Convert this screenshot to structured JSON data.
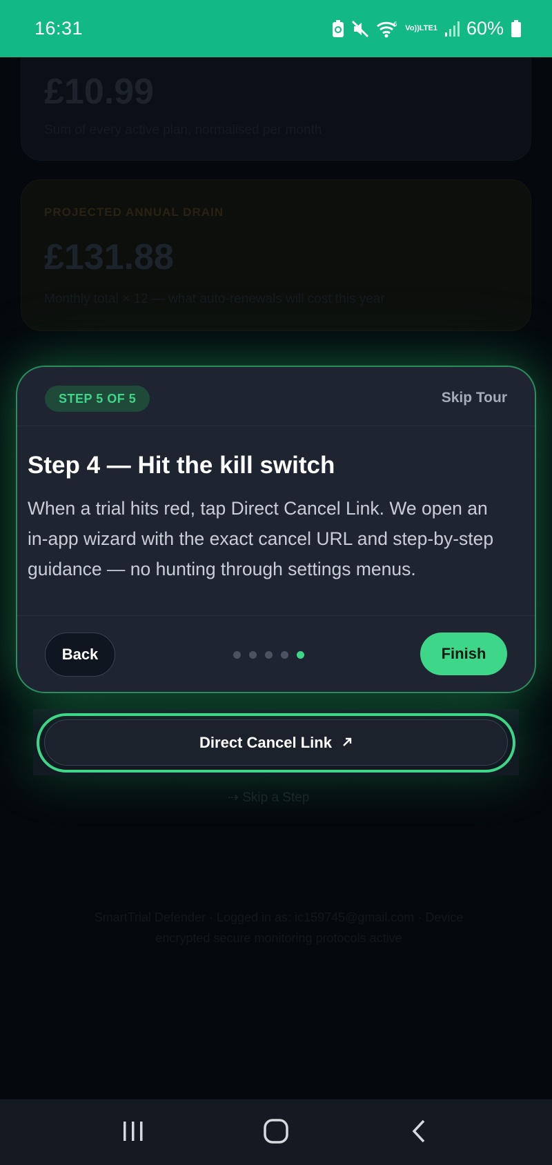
{
  "status_bar": {
    "time": "16:31",
    "network_label_top": "Vo))",
    "network_label_bottom": "LTE1",
    "battery_percent": "60%",
    "icons": [
      "battery-saver-icon",
      "mute-icon",
      "wifi-icon",
      "signal-icon",
      "battery-icon"
    ]
  },
  "background": {
    "monthly_amount": "£10.99",
    "monthly_caption": "Sum of every active plan, normalised per month",
    "annual_label": "PROJECTED ANNUAL DRAIN",
    "annual_amount": "£131.88",
    "annual_caption": "Monthly total × 12 — what auto-renewals will cost this year",
    "skip_link": "Skip a Step",
    "footer_line1": "SmartTrial Defender · Logged in as: ic159745@gmail.com · Device",
    "footer_line2": "encrypted secure monitoring protocols active"
  },
  "tour": {
    "step_badge": "STEP 5 OF 5",
    "skip_label": "Skip Tour",
    "title": "Step 4 — Hit the kill switch",
    "body": "When a trial hits red, tap Direct Cancel Link. We open an in-app wizard with the exact cancel URL and step-by-step guidance — no hunting through settings menus.",
    "back_label": "Back",
    "finish_label": "Finish",
    "total_steps": 5,
    "current_step": 5
  },
  "highlight": {
    "button_label": "Direct Cancel Link",
    "button_icon": "arrow-up-right-icon"
  },
  "colors": {
    "status_bar": "#12b985",
    "accent_green": "#3ed689",
    "card_bg": "#1f2431"
  },
  "navbar": {
    "icons": [
      "recent-apps-icon",
      "home-icon",
      "back-icon"
    ]
  }
}
